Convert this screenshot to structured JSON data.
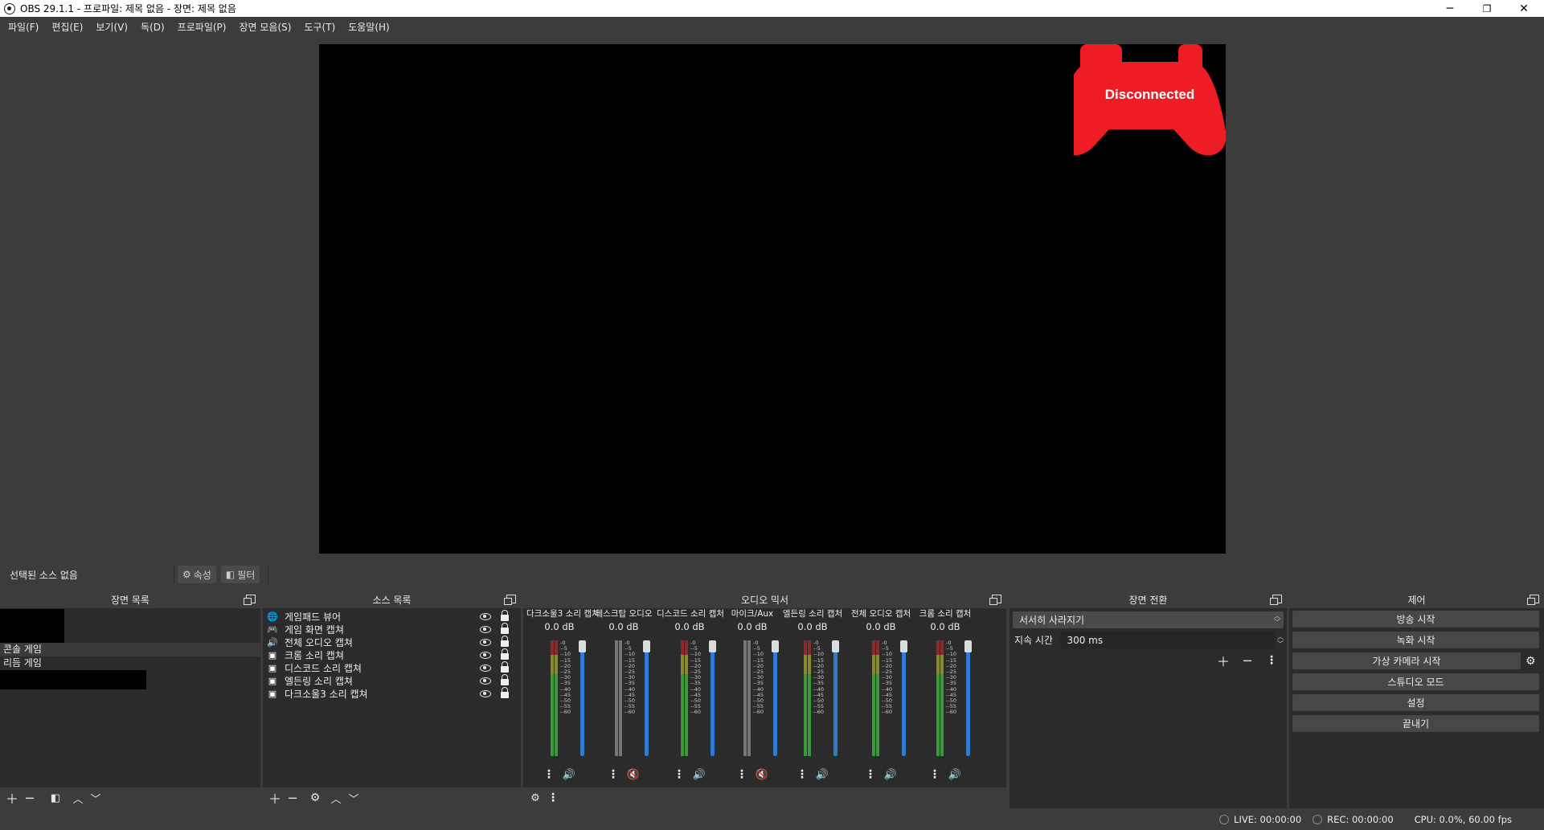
{
  "window": {
    "title": "OBS 29.1.1 - 프로파일: 제목 없음 - 장면: 제목 없음",
    "minimize": "─",
    "restore": "❐",
    "close": "✕"
  },
  "menu": [
    "파일(F)",
    "편집(E)",
    "보기(V)",
    "독(D)",
    "프로파일(P)",
    "장면 모음(S)",
    "도구(T)",
    "도움말(H)"
  ],
  "preview": {
    "gamepad_status": "Disconnected",
    "gamepad_color": "#ee1c25"
  },
  "source_toolbar": {
    "no_source": "선택된 소스 없음",
    "properties": "속성",
    "filters": "필터"
  },
  "scenes": {
    "title": "장면 목록",
    "items": [
      "",
      "콘솔 게임",
      "리듬 게임",
      ""
    ]
  },
  "sources": {
    "title": "소스 목록",
    "items": [
      {
        "label": "게임패드 뷰어",
        "icon": "globe-icon"
      },
      {
        "label": "게임 화면 캡쳐",
        "icon": "gamepad-icon"
      },
      {
        "label": "전체 오디오 캡쳐",
        "icon": "speaker-icon"
      },
      {
        "label": "크롬 소리 캡쳐",
        "icon": "app-audio-icon"
      },
      {
        "label": "디스코드 소리 캡쳐",
        "icon": "app-audio-icon"
      },
      {
        "label": "엘든링 소리 캡쳐",
        "icon": "app-audio-icon"
      },
      {
        "label": "다크소울3 소리 캡쳐",
        "icon": "app-audio-icon"
      }
    ]
  },
  "mixer": {
    "title": "오디오 믹서",
    "channels": [
      {
        "name": "다크소울3 소리 캡처",
        "db": "0.0 dB",
        "muted": false,
        "level": 0.72
      },
      {
        "name": "데스크탑 오디오",
        "db": "0.0 dB",
        "muted": true,
        "level": 0.0
      },
      {
        "name": "디스코드 소리 캡처",
        "db": "0.0 dB",
        "muted": false,
        "level": 0.72
      },
      {
        "name": "마이크/Aux",
        "db": "0.0 dB",
        "muted": true,
        "level": 0.0
      },
      {
        "name": "엘든링 소리 캡처",
        "db": "0.0 dB",
        "muted": false,
        "level": 0.72
      },
      {
        "name": "전체 오디오 캡처",
        "db": "0.0 dB",
        "muted": false,
        "level": 0.72
      },
      {
        "name": "크롬 소리 캡처",
        "db": "0.0 dB",
        "muted": false,
        "level": 0.72
      }
    ],
    "ticks": [
      "0",
      "-5",
      "-10",
      "-15",
      "-20",
      "-25",
      "-30",
      "-35",
      "-40",
      "-45",
      "-50",
      "-55",
      "-60"
    ]
  },
  "transitions": {
    "title": "장면 전환",
    "selected": "서서히 사라지기",
    "duration_label": "지속 시간",
    "duration_value": "300 ms"
  },
  "controls": {
    "title": "제어",
    "buttons": [
      "방송 시작",
      "녹화 시작",
      "가상 카메라 시작",
      "스튜디오 모드",
      "설정",
      "끝내기"
    ]
  },
  "status": {
    "live": "LIVE: 00:00:00",
    "rec": "REC: 00:00:00",
    "cpu": "CPU: 0.0%, 60.00 fps"
  }
}
